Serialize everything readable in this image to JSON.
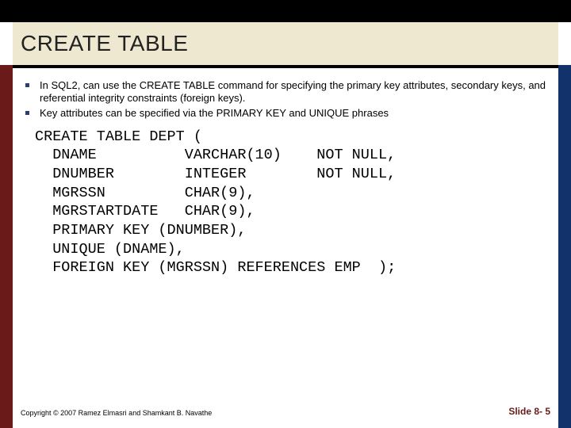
{
  "title": "CREATE TABLE",
  "bullets": [
    "In SQL2, can use the CREATE TABLE command for specifying the primary key attributes, secondary keys, and referential integrity constraints (foreign keys).",
    "Key attributes can be specified via the PRIMARY KEY and UNIQUE phrases"
  ],
  "code": "CREATE TABLE DEPT (\n  DNAME          VARCHAR(10)    NOT NULL,\n  DNUMBER        INTEGER        NOT NULL,\n  MGRSSN         CHAR(9),\n  MGRSTARTDATE   CHAR(9),\n  PRIMARY KEY (DNUMBER),\n  UNIQUE (DNAME),\n  FOREIGN KEY (MGRSSN) REFERENCES EMP  );",
  "copyright": "Copyright © 2007 Ramez Elmasri and Shamkant B. Navathe",
  "pagenum": "Slide 8- 5"
}
